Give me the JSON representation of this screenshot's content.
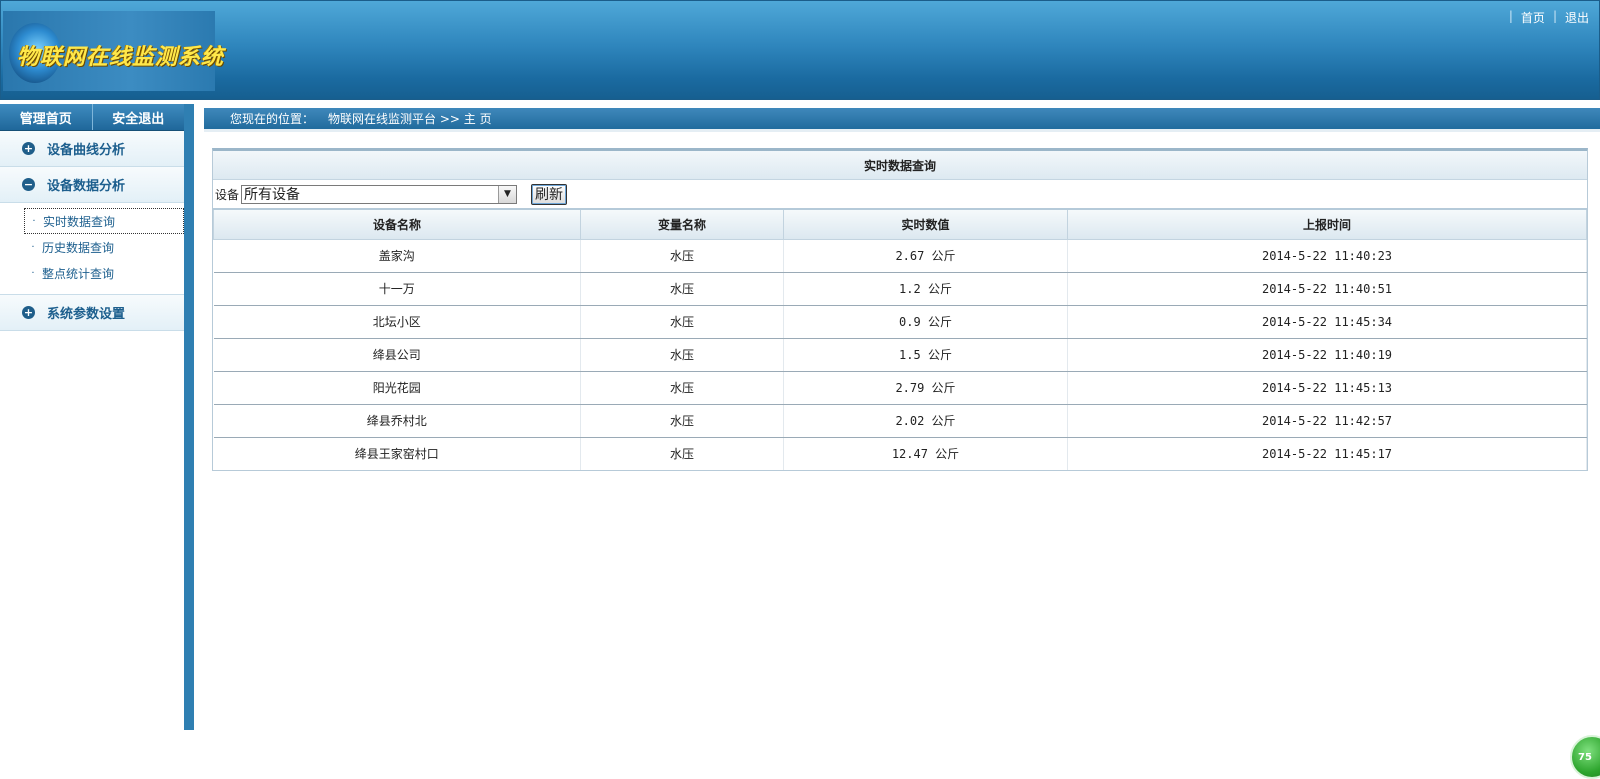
{
  "header": {
    "logo_text": "物联网在线监测系统",
    "links": [
      {
        "label": "首页"
      },
      {
        "label": "退出"
      }
    ]
  },
  "sidebar": {
    "tabs": [
      "管理首页",
      "安全退出"
    ],
    "sections": [
      {
        "label": "设备曲线分析",
        "icon": "plus-circle-icon"
      },
      {
        "label": "设备数据分析",
        "icon": "minus-circle-icon"
      },
      {
        "label": "系统参数设置",
        "icon": "plus-circle-icon"
      }
    ],
    "submenu": [
      {
        "label": "实时数据查询"
      },
      {
        "label": "历史数据查询"
      },
      {
        "label": "整点统计查询"
      }
    ]
  },
  "breadcrumb": {
    "label": "您现在的位置：",
    "path": "物联网在线监测平台 >> 主 页"
  },
  "panel": {
    "title": "实时数据查询",
    "filter_label": "设备",
    "filter_value": "所有设备",
    "refresh_label": "刷新"
  },
  "table": {
    "columns": [
      "设备名称",
      "变量名称",
      "实时数值",
      "上报时间"
    ],
    "rows": [
      [
        "盖家沟",
        "水压",
        "2.67 公斤",
        "2014-5-22 11:40:23"
      ],
      [
        "十一万",
        "水压",
        "1.2 公斤",
        "2014-5-22 11:40:51"
      ],
      [
        "北坛小区",
        "水压",
        "0.9 公斤",
        "2014-5-22 11:45:34"
      ],
      [
        "绛县公司",
        "水压",
        "1.5 公斤",
        "2014-5-22 11:40:19"
      ],
      [
        "阳光花园",
        "水压",
        "2.79 公斤",
        "2014-5-22 11:45:13"
      ],
      [
        "绛县乔村北",
        "水压",
        "2.02 公斤",
        "2014-5-22 11:42:57"
      ],
      [
        "绛县王家窑村口",
        "水压",
        "12.47 公斤",
        "2014-5-22 11:45:17"
      ]
    ]
  },
  "float_badge": "75",
  "colors": {
    "header_blue": "#2f86bd",
    "sidebar_border": "#2f7fb2",
    "link_blue": "#1d5f8e",
    "logo_yellow": "#ffe84a"
  }
}
